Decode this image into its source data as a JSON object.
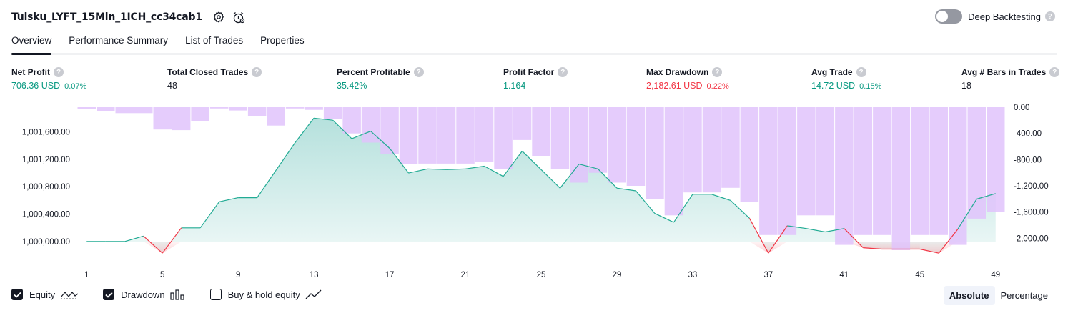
{
  "header": {
    "strategy_name": "Tuisku_LYFT_15Min_1ICH_cc34cab1",
    "deep_backtesting_label": "Deep Backtesting",
    "help_glyph": "?"
  },
  "tabs": [
    {
      "label": "Overview",
      "active": true
    },
    {
      "label": "Performance Summary",
      "active": false
    },
    {
      "label": "List of Trades",
      "active": false
    },
    {
      "label": "Properties",
      "active": false
    }
  ],
  "metrics": [
    {
      "label": "Net Profit",
      "value": "706.36 USD",
      "pct": "0.07%",
      "color": "#089981"
    },
    {
      "label": "Total Closed Trades",
      "value": "48",
      "pct": "",
      "color": "#131722"
    },
    {
      "label": "Percent Profitable",
      "value": "35.42%",
      "pct": "",
      "color": "#089981"
    },
    {
      "label": "Profit Factor",
      "value": "1.164",
      "pct": "",
      "color": "#089981"
    },
    {
      "label": "Max Drawdown",
      "value": "2,182.61 USD",
      "pct": "0.22%",
      "color": "#f23645"
    },
    {
      "label": "Avg Trade",
      "value": "14.72 USD",
      "pct": "0.15%",
      "color": "#089981"
    },
    {
      "label": "Avg # Bars in Trades",
      "value": "18",
      "pct": "",
      "color": "#131722"
    }
  ],
  "chart_data": {
    "type": "area",
    "x": [
      1,
      2,
      3,
      4,
      5,
      6,
      7,
      8,
      9,
      10,
      11,
      12,
      13,
      14,
      15,
      16,
      17,
      18,
      19,
      20,
      21,
      22,
      23,
      24,
      25,
      26,
      27,
      28,
      29,
      30,
      31,
      32,
      33,
      34,
      35,
      36,
      37,
      38,
      39,
      40,
      41,
      42,
      43,
      44,
      45,
      46,
      47,
      48,
      49
    ],
    "x_tick_labels": [
      "1",
      "5",
      "9",
      "13",
      "17",
      "21",
      "25",
      "29",
      "33",
      "37",
      "41",
      "45",
      "49"
    ],
    "equity": [
      1000000,
      1000000,
      1000000,
      1000080,
      999830,
      1000200,
      1000200,
      1000580,
      1000640,
      1000640,
      1001040,
      1001440,
      1001800,
      1001770,
      1001500,
      1001610,
      1001360,
      1001000,
      1001060,
      1001050,
      1001060,
      1001100,
      1000950,
      1001320,
      1001050,
      1000780,
      1001130,
      1001060,
      1000780,
      1000740,
      1000410,
      1000280,
      1000690,
      1000690,
      1000600,
      1000340,
      999830,
      1000230,
      1000190,
      1000140,
      1000190,
      999910,
      999890,
      999890,
      999890,
      999830,
      1000180,
      1000620,
      1000700
    ],
    "drawdown": [
      -30,
      -60,
      -90,
      -90,
      -340,
      -350,
      -210,
      -20,
      -50,
      -140,
      -280,
      -20,
      -40,
      -180,
      -400,
      -540,
      -720,
      -870,
      -860,
      -860,
      -860,
      -830,
      -940,
      -500,
      -750,
      -940,
      -1150,
      -1000,
      -1150,
      -1200,
      -1400,
      -1650,
      -1300,
      -1300,
      -1230,
      -1450,
      -1950,
      -1950,
      -1650,
      -1650,
      -2100,
      -1950,
      -1950,
      -2180,
      -1950,
      -1950,
      -2100,
      -1700,
      -1600
    ],
    "left_axis_ticks": [
      "1,001,600.00",
      "1,001,200.00",
      "1,000,800.00",
      "1,000,400.00",
      "1,000,000.00"
    ],
    "left_axis_values": [
      1001600,
      1001200,
      1000800,
      1000400,
      1000000
    ],
    "right_axis_ticks": [
      "0.00",
      "-400.00",
      "-800.00",
      "-1,200.00",
      "-1,600.00",
      "-2,000.00"
    ],
    "right_axis_values": [
      0,
      -400,
      -800,
      -1200,
      -1600,
      -2000
    ],
    "ylim_equity": [
      999770,
      1001960
    ],
    "ylim_drawdown": [
      -2290,
      0
    ],
    "colors": {
      "equity_line": "#22ab94",
      "equity_fill": "#26a69a",
      "below_line": "#f23645",
      "drawdown_bar": "#e0c3fc",
      "drawdown_bar_overlap": "#b5b9e8"
    }
  },
  "legend": [
    {
      "label": "Equity",
      "checked": true,
      "icon": "equity-line-icon"
    },
    {
      "label": "Drawdown",
      "checked": true,
      "icon": "bars-icon"
    },
    {
      "label": "Buy & hold equity",
      "checked": false,
      "icon": "trend-line-icon"
    }
  ],
  "mode_toggle": {
    "absolute": "Absolute",
    "percentage": "Percentage",
    "active": "absolute"
  }
}
